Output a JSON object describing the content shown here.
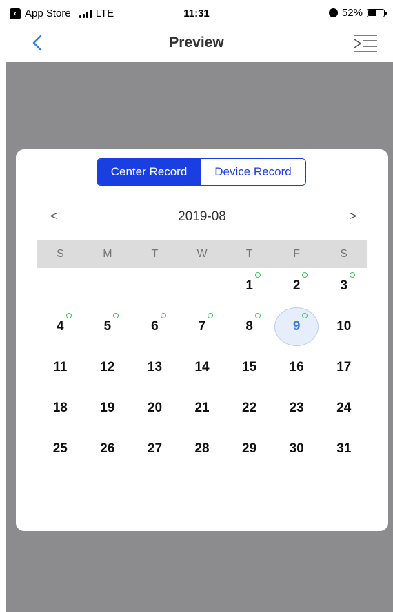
{
  "status_bar": {
    "carrier": "App Store",
    "network": "LTE",
    "time": "11:31",
    "battery": "52%"
  },
  "nav": {
    "title": "Preview",
    "back_icon": "chevron-left-icon",
    "menu_icon": "list-menu-icon"
  },
  "tabs": {
    "center": "Center Record",
    "device": "Device Record",
    "active": "center"
  },
  "calendar": {
    "month": "2019-08",
    "prev": "<",
    "next": ">",
    "weekdays": [
      "S",
      "M",
      "T",
      "W",
      "T",
      "F",
      "S"
    ],
    "weeks": [
      [
        "",
        "",
        "",
        "",
        "1",
        "2",
        "3"
      ],
      [
        "4",
        "5",
        "6",
        "7",
        "8",
        "9",
        "10"
      ],
      [
        "11",
        "12",
        "13",
        "14",
        "15",
        "16",
        "17"
      ],
      [
        "18",
        "19",
        "20",
        "21",
        "22",
        "23",
        "24"
      ],
      [
        "25",
        "26",
        "27",
        "28",
        "29",
        "30",
        "31"
      ]
    ],
    "days_with_records": [
      "1",
      "2",
      "3",
      "4",
      "5",
      "6",
      "7",
      "8",
      "9"
    ],
    "selected_day": "9"
  },
  "colors": {
    "accent": "#1a3fe0",
    "record_dot": "#3fbf5f",
    "selected": "#3a7de0",
    "overlay": "#8c8c8e"
  }
}
